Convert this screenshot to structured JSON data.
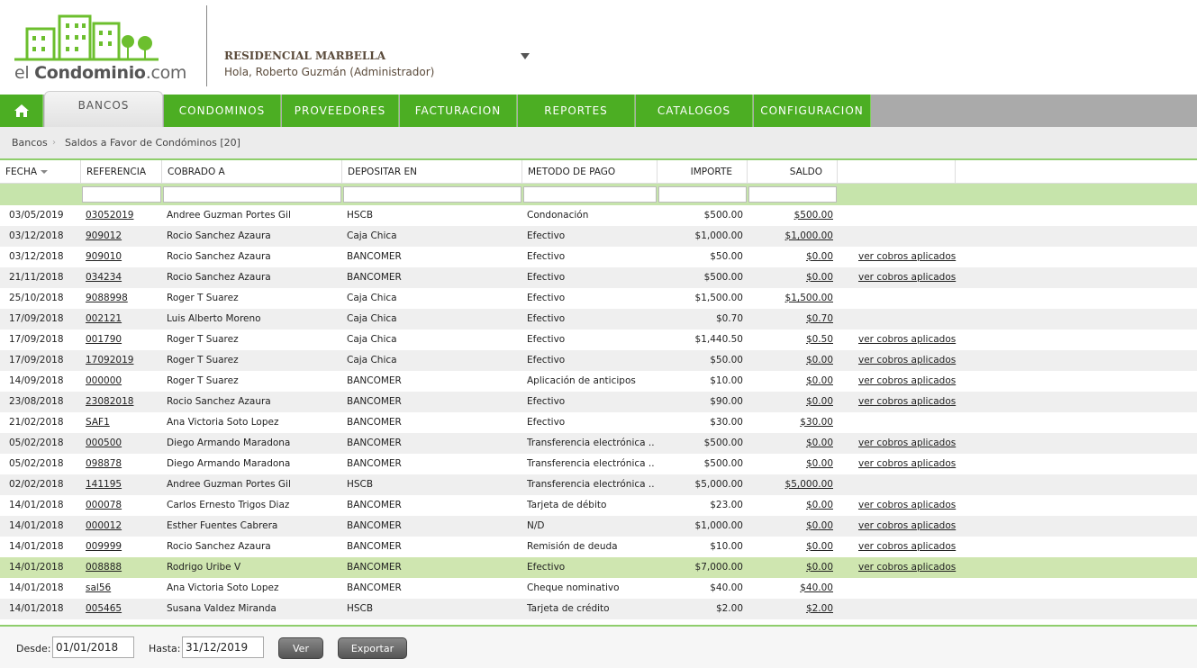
{
  "brand": {
    "logo_prefix": "el ",
    "logo_bold": "Condominio",
    "logo_suffix": ".com"
  },
  "header": {
    "org_name": "RESIDENCIAL MARBELLA",
    "greeting": "Hola, Roberto Guzmán (Administrador)"
  },
  "nav": {
    "home_icon": "home-icon",
    "active_tab": "BANCOS",
    "items": [
      "CONDOMINOS",
      "PROVEEDORES",
      "FACTURACION",
      "REPORTES",
      "CATALOGOS",
      "CONFIGURACION"
    ]
  },
  "breadcrumb": {
    "root": "Bancos",
    "current": "Saldos a Favor de Condóminos [20]"
  },
  "table": {
    "columns": [
      "FECHA",
      "REFERENCIA",
      "COBRADO A",
      "DEPOSITAR EN",
      "METODO DE PAGO",
      "IMPORTE",
      "SALDO"
    ],
    "link_label": "ver cobros aplicados",
    "rows": [
      {
        "fecha": "03/05/2019",
        "ref": "03052019",
        "cobrado": "Andree Guzman Portes Gil",
        "depositar": "HSCB",
        "metodo": "Condonación",
        "importe": "$500.00",
        "saldo": "$500.00",
        "link": ""
      },
      {
        "fecha": "03/12/2018",
        "ref": "909012",
        "cobrado": "Rocio Sanchez Azaura",
        "depositar": "Caja Chica",
        "metodo": "Efectivo",
        "importe": "$1,000.00",
        "saldo": "$1,000.00",
        "link": ""
      },
      {
        "fecha": "03/12/2018",
        "ref": "909010",
        "cobrado": "Rocio Sanchez Azaura",
        "depositar": "BANCOMER",
        "metodo": "Efectivo",
        "importe": "$50.00",
        "saldo": "$0.00",
        "link": "ver cobros aplicados"
      },
      {
        "fecha": "21/11/2018",
        "ref": "034234",
        "cobrado": "Rocio Sanchez Azaura",
        "depositar": "BANCOMER",
        "metodo": "Efectivo",
        "importe": "$500.00",
        "saldo": "$0.00",
        "link": "ver cobros aplicados"
      },
      {
        "fecha": "25/10/2018",
        "ref": "9088998",
        "cobrado": "Roger T Suarez",
        "depositar": "Caja Chica",
        "metodo": "Efectivo",
        "importe": "$1,500.00",
        "saldo": "$1,500.00",
        "link": ""
      },
      {
        "fecha": "17/09/2018",
        "ref": "002121",
        "cobrado": "Luis Alberto Moreno",
        "depositar": "Caja Chica",
        "metodo": "Efectivo",
        "importe": "$0.70",
        "saldo": "$0.70",
        "link": ""
      },
      {
        "fecha": "17/09/2018",
        "ref": "001790",
        "cobrado": "Roger T Suarez",
        "depositar": "Caja Chica",
        "metodo": "Efectivo",
        "importe": "$1,440.50",
        "saldo": "$0.50",
        "link": "ver cobros aplicados"
      },
      {
        "fecha": "17/09/2018",
        "ref": "17092019",
        "cobrado": "Roger T Suarez",
        "depositar": "Caja Chica",
        "metodo": "Efectivo",
        "importe": "$50.00",
        "saldo": "$0.00",
        "link": "ver cobros aplicados"
      },
      {
        "fecha": "14/09/2018",
        "ref": "000000",
        "cobrado": "Roger T Suarez",
        "depositar": "BANCOMER",
        "metodo": "Aplicación de anticipos",
        "importe": "$10.00",
        "saldo": "$0.00",
        "link": "ver cobros aplicados"
      },
      {
        "fecha": "23/08/2018",
        "ref": "23082018",
        "cobrado": "Rocio Sanchez Azaura",
        "depositar": "BANCOMER",
        "metodo": "Efectivo",
        "importe": "$90.00",
        "saldo": "$0.00",
        "link": "ver cobros aplicados"
      },
      {
        "fecha": "21/02/2018",
        "ref": "SAF1",
        "cobrado": "Ana Victoria Soto Lopez",
        "depositar": "BANCOMER",
        "metodo": "Efectivo",
        "importe": "$30.00",
        "saldo": "$30.00",
        "link": ""
      },
      {
        "fecha": "05/02/2018",
        "ref": "000500",
        "cobrado": "Diego Armando Maradona",
        "depositar": "BANCOMER",
        "metodo": "Transferencia electrónica ...",
        "importe": "$500.00",
        "saldo": "$0.00",
        "link": "ver cobros aplicados"
      },
      {
        "fecha": "05/02/2018",
        "ref": "098878",
        "cobrado": "Diego Armando Maradona",
        "depositar": "BANCOMER",
        "metodo": "Transferencia electrónica ...",
        "importe": "$500.00",
        "saldo": "$0.00",
        "link": "ver cobros aplicados"
      },
      {
        "fecha": "02/02/2018",
        "ref": "141195",
        "cobrado": "Andree Guzman Portes Gil",
        "depositar": "HSCB",
        "metodo": "Transferencia electrónica ...",
        "importe": "$5,000.00",
        "saldo": "$5,000.00",
        "link": ""
      },
      {
        "fecha": "14/01/2018",
        "ref": "000078",
        "cobrado": "Carlos Ernesto Trigos Diaz",
        "depositar": "BANCOMER",
        "metodo": "Tarjeta de débito",
        "importe": "$23.00",
        "saldo": "$0.00",
        "link": "ver cobros aplicados"
      },
      {
        "fecha": "14/01/2018",
        "ref": "000012",
        "cobrado": "Esther Fuentes Cabrera",
        "depositar": "BANCOMER",
        "metodo": "N/D",
        "importe": "$1,000.00",
        "saldo": "$0.00",
        "link": "ver cobros aplicados"
      },
      {
        "fecha": "14/01/2018",
        "ref": "009999",
        "cobrado": "Rocio Sanchez Azaura",
        "depositar": "BANCOMER",
        "metodo": "Remisión de deuda",
        "importe": "$10.00",
        "saldo": "$0.00",
        "link": "ver cobros aplicados"
      },
      {
        "fecha": "14/01/2018",
        "ref": "008888",
        "cobrado": "Rodrigo Uribe V",
        "depositar": "BANCOMER",
        "metodo": "Efectivo",
        "importe": "$7,000.00",
        "saldo": "$0.00",
        "link": "ver cobros aplicados"
      },
      {
        "fecha": "14/01/2018",
        "ref": "sal56",
        "cobrado": "Ana Victoria Soto Lopez",
        "depositar": "BANCOMER",
        "metodo": "Cheque nominativo",
        "importe": "$40.00",
        "saldo": "$40.00",
        "link": ""
      },
      {
        "fecha": "14/01/2018",
        "ref": "005465",
        "cobrado": "Susana Valdez Miranda",
        "depositar": "HSCB",
        "metodo": "Tarjeta de crédito",
        "importe": "$2.00",
        "saldo": "$2.00",
        "link": ""
      }
    ],
    "selected_row_ref": "008888"
  },
  "footer": {
    "desde_label": "Desde:",
    "desde_value": "01/01/2018",
    "hasta_label": "Hasta:",
    "hasta_value": "31/12/2019",
    "ver_label": "Ver",
    "exportar_label": "Exportar"
  },
  "colors": {
    "accent_green": "#4cae23",
    "filter_green": "#c6e4ab",
    "selected_row": "#cfe6b0"
  }
}
